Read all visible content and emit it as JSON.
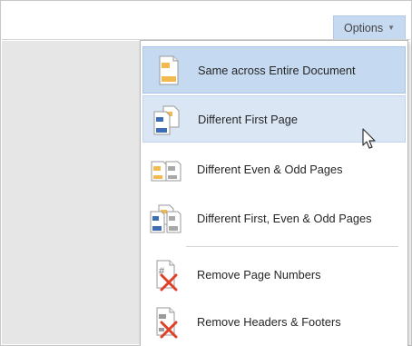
{
  "toolbar": {
    "options_label": "Options",
    "options_icon": "chevron-down-icon"
  },
  "menu": {
    "items": [
      {
        "label": "Same across Entire Document",
        "icon": "page-header-icon",
        "state": "selected"
      },
      {
        "label": "Different First Page",
        "icon": "first-page-header-icon",
        "state": "hover"
      },
      {
        "label": "Different Even & Odd Pages",
        "icon": "even-odd-pages-icon",
        "state": "normal"
      },
      {
        "label": "Different First, Even & Odd Pages",
        "icon": "first-even-odd-pages-icon",
        "state": "normal"
      },
      {
        "label": "Remove Page Numbers",
        "icon": "remove-page-numbers-icon",
        "state": "normal"
      },
      {
        "label": "Remove Headers & Footers",
        "icon": "remove-headers-footers-icon",
        "state": "normal"
      }
    ]
  },
  "colors": {
    "selected_bg": "#c5d9f1",
    "hover_bg": "#dbe6f5",
    "icon_orange": "#f2b94e",
    "icon_blue": "#3e6db5",
    "icon_gray": "#a8a8a8",
    "remove_red": "#e0402a"
  }
}
